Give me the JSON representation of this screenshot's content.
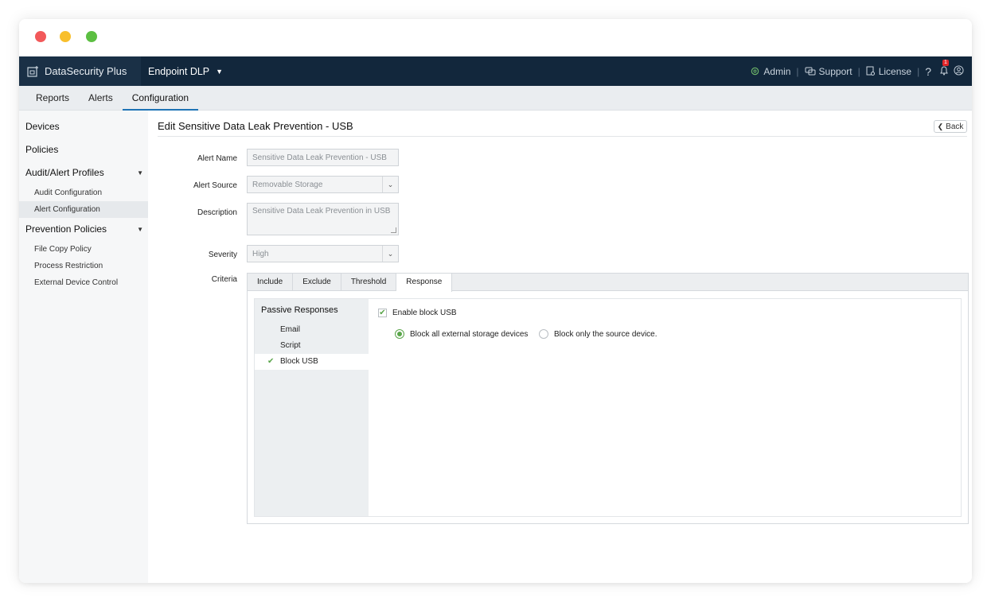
{
  "app": {
    "brand": "DataSecurity Plus",
    "product": "Endpoint DLP"
  },
  "topbar": {
    "admin": "Admin",
    "support": "Support",
    "license": "License",
    "help": "?",
    "notification_count": "1"
  },
  "subnav": {
    "tabs": [
      "Reports",
      "Alerts",
      "Configuration"
    ],
    "active": "Configuration"
  },
  "sidebar": {
    "devices": "Devices",
    "policies": "Policies",
    "audit_profiles": "Audit/Alert Profiles",
    "audit_items": [
      "Audit Configuration",
      "Alert Configuration"
    ],
    "prevention": "Prevention Policies",
    "prevention_items": [
      "File Copy Policy",
      "Process Restriction",
      "External Device Control"
    ]
  },
  "page": {
    "title": "Edit Sensitive Data Leak Prevention - USB",
    "back": "Back"
  },
  "form": {
    "alert_name_label": "Alert Name",
    "alert_name_value": "Sensitive Data Leak Prevention - USB",
    "alert_source_label": "Alert Source",
    "alert_source_value": "Removable Storage",
    "description_label": "Description",
    "description_value": "Sensitive Data Leak Prevention in USB",
    "severity_label": "Severity",
    "severity_value": "High",
    "criteria_label": "Criteria"
  },
  "criteria": {
    "tabs": [
      "Include",
      "Exclude",
      "Threshold",
      "Response"
    ],
    "active_tab": "Response",
    "passive_responses": "Passive Responses",
    "responses": [
      "Email",
      "Script",
      "Block USB"
    ],
    "active_response": "Block USB",
    "enable_label": "Enable block USB",
    "option_all": "Block all external storage devices",
    "option_source": "Block only the source device."
  },
  "colors": {
    "nav_bg": "#12273c",
    "accent_green": "#5aa54a",
    "tab_underline": "#1e73b5"
  }
}
